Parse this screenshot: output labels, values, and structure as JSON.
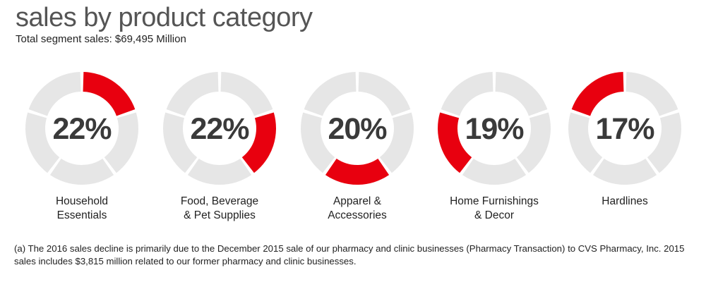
{
  "title": "sales by product category",
  "subtitle": "Total segment sales: $69,495 Million",
  "footnote": "(a) The 2016 sales decline is primarily due to the December 2015 sale of our pharmacy and clinic businesses (Pharmacy Transaction) to CVS Pharmacy, Inc. 2015 sales includes $3,815 million related to our former pharmacy and clinic businesses.",
  "colors": {
    "accent": "#e8000f",
    "track": "#e6e6e6",
    "value_text": "#3a3a3a"
  },
  "chart_data": {
    "type": "pie",
    "style": "donut",
    "categories": [
      "Household\nEssentials",
      "Food, Beverage\n& Pet Supplies",
      "Apparel &\nAccessories",
      "Home Furnishings\n& Decor",
      "Hardlines"
    ],
    "values": [
      22,
      22,
      20,
      19,
      17
    ],
    "value_labels": [
      "22%",
      "22%",
      "20%",
      "19%",
      "17%"
    ],
    "unit": "%",
    "segments_per_ring": 5,
    "highlighted_segment": [
      0,
      1,
      2,
      3,
      4
    ]
  }
}
